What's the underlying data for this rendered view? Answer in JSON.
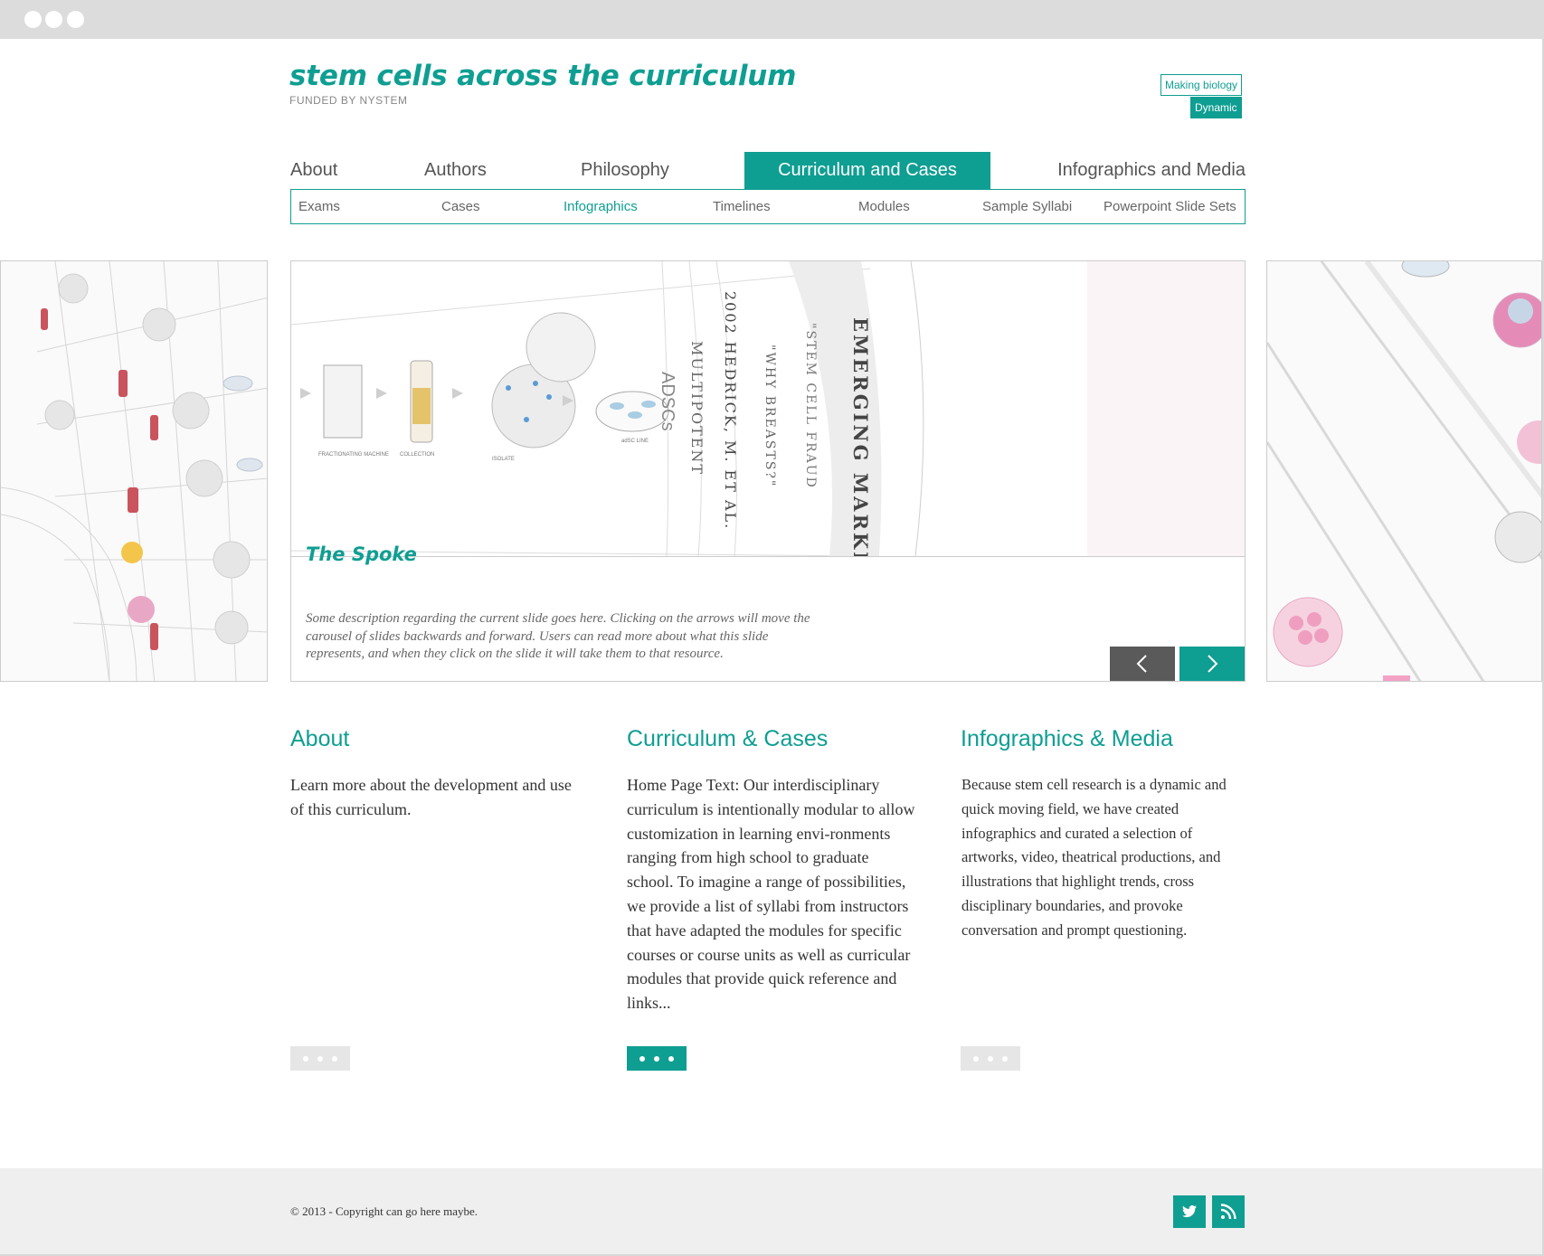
{
  "header": {
    "title": "stem cells across the curriculum",
    "subtitle": "FUNDED BY NYSTEM",
    "tagline_line1": "Making biology",
    "tagline_line2": "Dynamic"
  },
  "nav": {
    "items": [
      {
        "label": "About"
      },
      {
        "label": "Authors"
      },
      {
        "label": "Philosophy"
      },
      {
        "label": "Curriculum and Cases"
      },
      {
        "label": "Infographics and Media"
      }
    ],
    "active_index": 3
  },
  "subnav": {
    "items": [
      {
        "label": "Exams"
      },
      {
        "label": "Cases"
      },
      {
        "label": "Infographics"
      },
      {
        "label": "Timelines"
      },
      {
        "label": "Modules"
      },
      {
        "label": "Sample Syllabi"
      },
      {
        "label": "Powerpoint Slide Sets"
      }
    ],
    "active_index": 2
  },
  "carousel": {
    "slide_title": "The Spoke",
    "slide_description": "Some description regarding the current slide goes here. Clicking on the arrows will move the carousel of slides backwards and forward. Users can read more about what this slide represents, and when they click on the slide it will take them to that resource.",
    "art_labels": {
      "emerging": "EMERGING MARKETS",
      "fraud": "\"STEM CELL FRAUD",
      "breasts": "\"WHY BREASTS?\"",
      "hedrick": "2002 HEDRICK, M. ET AL.",
      "multipotent": "MULTIPOTENT",
      "adscs": "ADSCs",
      "fractionating": "FRACTIONATING MACHINE",
      "collection": "COLLECTION",
      "isolate": "ISOLATE",
      "adsc_line": "adSC LINE"
    },
    "prev_label": "previous",
    "next_label": "next"
  },
  "columns": [
    {
      "title": "About",
      "body": "Learn more about the development and use of this curriculum."
    },
    {
      "title": "Curriculum & Cases",
      "body": "Home Page Text: Our interdisciplinary curriculum is intentionally modular to allow customization in learning envi-ronments ranging from high school to graduate school. To imagine a range of possibilities, we provide a list of syllabi from instructors that have adapted the modules for specific courses or course units  as well as  curricular modules that provide quick reference and links..."
    },
    {
      "title": "Infographics & Media",
      "body": "Because stem cell research is a dynamic and quick moving field, we have created infographics and curated a selection of artworks, video, theatrical productions, and illustrations  that highlight trends, cross disciplinary boundaries, and provoke conversation and prompt questioning."
    }
  ],
  "footer": {
    "copyright": "© 2013 - Copyright can go here maybe."
  },
  "colors": {
    "accent": "#0f9e92",
    "dark_button": "#5a5a5a",
    "muted_button": "#e6e6e6",
    "footer_bg": "#efefef"
  },
  "icons": [
    "twitter-icon",
    "rss-icon",
    "chevron-left-icon",
    "chevron-right-icon"
  ]
}
